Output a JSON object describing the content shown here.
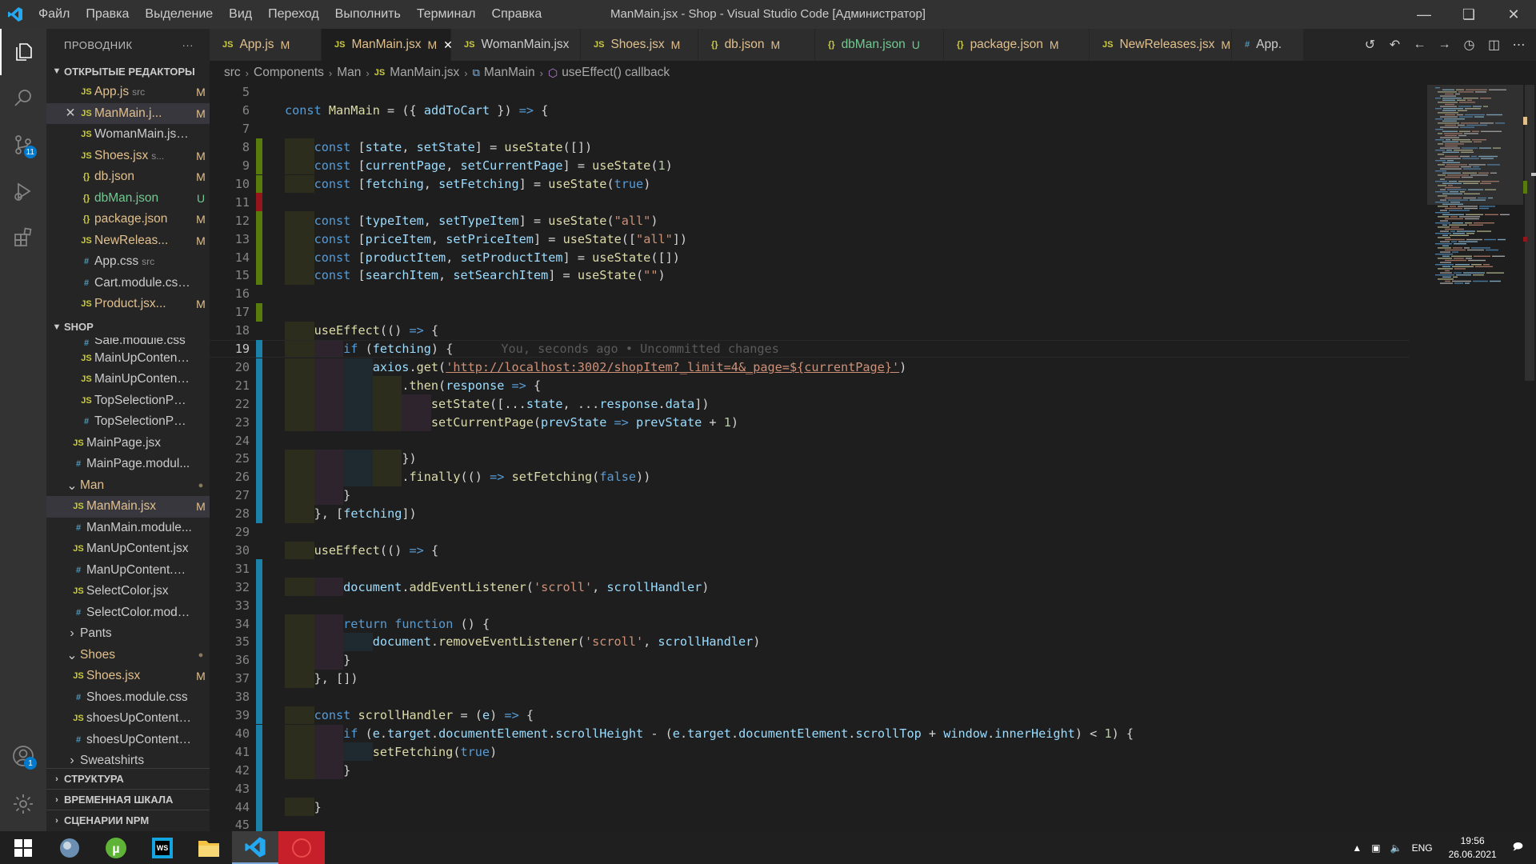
{
  "window": {
    "title": "ManMain.jsx - Shop - Visual Studio Code [Администратор]",
    "menu": [
      "Файл",
      "Правка",
      "Выделение",
      "Вид",
      "Переход",
      "Выполнить",
      "Терминал",
      "Справка"
    ]
  },
  "activity_bar": {
    "source_control_badge": "11",
    "accounts_badge": "1"
  },
  "sidebar": {
    "title": "ПРОВОДНИК",
    "more": "···",
    "open_editors_title": "ОТКРЫТЫЕ РЕДАКТОРЫ",
    "open_editors": [
      {
        "icon": "JS",
        "name": "App.js",
        "hint": "src",
        "status": "M"
      },
      {
        "icon": "JS",
        "name": "ManMain.j...",
        "hint": "",
        "status": "M"
      },
      {
        "icon": "JS",
        "name": "WomanMain.jsx...",
        "hint": "",
        "status": ""
      },
      {
        "icon": "JS",
        "name": "Shoes.jsx",
        "hint": "s...",
        "status": "M"
      },
      {
        "icon": "{}",
        "name": "db.json",
        "hint": "",
        "status": "M"
      },
      {
        "icon": "{}",
        "name": "dbMan.json",
        "hint": "",
        "status": "U"
      },
      {
        "icon": "{}",
        "name": "package.json",
        "hint": "",
        "status": "M"
      },
      {
        "icon": "JS",
        "name": "NewReleas...",
        "hint": "",
        "status": "M"
      },
      {
        "icon": "#",
        "name": "App.css",
        "hint": "src",
        "status": ""
      },
      {
        "icon": "#",
        "name": "Cart.module.css...",
        "hint": "",
        "status": ""
      },
      {
        "icon": "JS",
        "name": "Product.jsx...",
        "hint": "",
        "status": "M"
      }
    ],
    "shop_title": "SHOP",
    "shop_items": [
      {
        "icon": "#",
        "name": "Sale.module.css",
        "status": ""
      },
      {
        "icon": "JS",
        "name": "MainUpContent....",
        "status": ""
      },
      {
        "icon": "JS",
        "name": "MainUpContent....",
        "status": ""
      },
      {
        "icon": "JS",
        "name": "TopSelectionPan...",
        "status": ""
      },
      {
        "icon": "#",
        "name": "TopSelectionPan...",
        "status": ""
      },
      {
        "icon": "JS",
        "name": "MainPage.jsx",
        "status": ""
      },
      {
        "icon": "#",
        "name": "MainPage.modul...",
        "status": ""
      },
      {
        "icon": "folder",
        "name": "Man",
        "status": "●"
      },
      {
        "icon": "JS",
        "name": "ManMain.jsx",
        "status": "M"
      },
      {
        "icon": "#",
        "name": "ManMain.module...",
        "status": ""
      },
      {
        "icon": "JS",
        "name": "ManUpContent.jsx",
        "status": ""
      },
      {
        "icon": "#",
        "name": "ManUpContent.m...",
        "status": ""
      },
      {
        "icon": "JS",
        "name": "SelectColor.jsx",
        "status": ""
      },
      {
        "icon": "#",
        "name": "SelectColor.modu...",
        "status": ""
      },
      {
        "icon": "folder-closed",
        "name": "Pants",
        "status": ""
      },
      {
        "icon": "folder",
        "name": "Shoes",
        "status": "●"
      },
      {
        "icon": "JS",
        "name": "Shoes.jsx",
        "status": "M"
      },
      {
        "icon": "#",
        "name": "Shoes.module.css",
        "status": ""
      },
      {
        "icon": "JS",
        "name": "shoesUpContent.j...",
        "status": ""
      },
      {
        "icon": "#",
        "name": "shoesUpContent....",
        "status": ""
      },
      {
        "icon": "folder-closed",
        "name": "Sweatshirts",
        "status": ""
      }
    ],
    "bottom_sections": [
      "СТРУКТУРА",
      "ВРЕМЕННАЯ ШКАЛА",
      "СЦЕНАРИИ NPM"
    ]
  },
  "tabs": [
    {
      "icon": "JS",
      "label": "App.js",
      "status": "M"
    },
    {
      "icon": "JS",
      "label": "ManMain.jsx",
      "status": "M"
    },
    {
      "icon": "JS",
      "label": "WomanMain.jsx",
      "status": ""
    },
    {
      "icon": "JS",
      "label": "Shoes.jsx",
      "status": "M"
    },
    {
      "icon": "{}",
      "label": "db.json",
      "status": "M"
    },
    {
      "icon": "{}",
      "label": "dbMan.json",
      "status": "U"
    },
    {
      "icon": "{}",
      "label": "package.json",
      "status": "M"
    },
    {
      "icon": "JS",
      "label": "NewReleases.jsx",
      "status": "M"
    },
    {
      "icon": "#",
      "label": "App.",
      "status": ""
    }
  ],
  "breadcrumb": [
    "src",
    "Components",
    "Man",
    "ManMain.jsx",
    "ManMain",
    "useEffect() callback"
  ],
  "editor": {
    "blame": "You, seconds ago • Uncommitted changes",
    "lines": [
      {
        "n": "5",
        "t": ""
      },
      {
        "n": "6",
        "t": "const ManMain = ({ addToCart }) => {"
      },
      {
        "n": "7",
        "t": ""
      },
      {
        "n": "8",
        "t": "    const [state, setState] = useState([])"
      },
      {
        "n": "9",
        "t": "    const [currentPage, setCurrentPage] = useState(1)"
      },
      {
        "n": "10",
        "t": "    const [fetching, setFetching] = useState(true)"
      },
      {
        "n": "11",
        "t": ""
      },
      {
        "n": "12",
        "t": "    const [typeItem, setTypeItem] = useState(\"all\")"
      },
      {
        "n": "13",
        "t": "    const [priceItem, setPriceItem] = useState([\"all\"])"
      },
      {
        "n": "14",
        "t": "    const [productItem, setProductItem] = useState([])"
      },
      {
        "n": "15",
        "t": "    const [searchItem, setSearchItem] = useState(\"\")"
      },
      {
        "n": "16",
        "t": ""
      },
      {
        "n": "17",
        "t": ""
      },
      {
        "n": "18",
        "t": "    useEffect(() => {"
      },
      {
        "n": "19",
        "t": "        if (fetching) {"
      },
      {
        "n": "20",
        "t": "            axios.get('http://localhost:3002/shopItem?_limit=4&_page=${currentPage}')"
      },
      {
        "n": "21",
        "t": "                .then(response => {"
      },
      {
        "n": "22",
        "t": "                    setState([...state, ...response.data])"
      },
      {
        "n": "23",
        "t": "                    setCurrentPage(prevState => prevState + 1)"
      },
      {
        "n": "24",
        "t": ""
      },
      {
        "n": "25",
        "t": "                })"
      },
      {
        "n": "26",
        "t": "                .finally(() => setFetching(false))"
      },
      {
        "n": "27",
        "t": "        }"
      },
      {
        "n": "28",
        "t": "    }, [fetching])"
      },
      {
        "n": "29",
        "t": ""
      },
      {
        "n": "30",
        "t": "    useEffect(() => {"
      },
      {
        "n": "31",
        "t": ""
      },
      {
        "n": "32",
        "t": "        document.addEventListener('scroll', scrollHandler)"
      },
      {
        "n": "33",
        "t": ""
      },
      {
        "n": "34",
        "t": "        return function () {"
      },
      {
        "n": "35",
        "t": "            document.removeEventListener('scroll', scrollHandler)"
      },
      {
        "n": "36",
        "t": "        }"
      },
      {
        "n": "37",
        "t": "    }, [])"
      },
      {
        "n": "38",
        "t": ""
      },
      {
        "n": "39",
        "t": "    const scrollHandler = (e) => {"
      },
      {
        "n": "40",
        "t": "        if (e.target.documentElement.scrollHeight - (e.target.documentElement.scrollTop + window.innerHeight) < 1) {"
      },
      {
        "n": "41",
        "t": "            setFetching(true)"
      },
      {
        "n": "42",
        "t": "        }"
      },
      {
        "n": "43",
        "t": ""
      },
      {
        "n": "44",
        "t": "    }"
      },
      {
        "n": "45",
        "t": ""
      }
    ]
  },
  "taskbar": {
    "lang": "ENG",
    "time": "19:56",
    "date": "26.06.2021"
  },
  "colors": {
    "accent": "#007acc",
    "keyword": "#569cd6",
    "function": "#dcdcaa",
    "variable": "#9cdcfe",
    "string": "#ce9178",
    "modified": "#e2c08d",
    "untracked": "#73c991"
  }
}
